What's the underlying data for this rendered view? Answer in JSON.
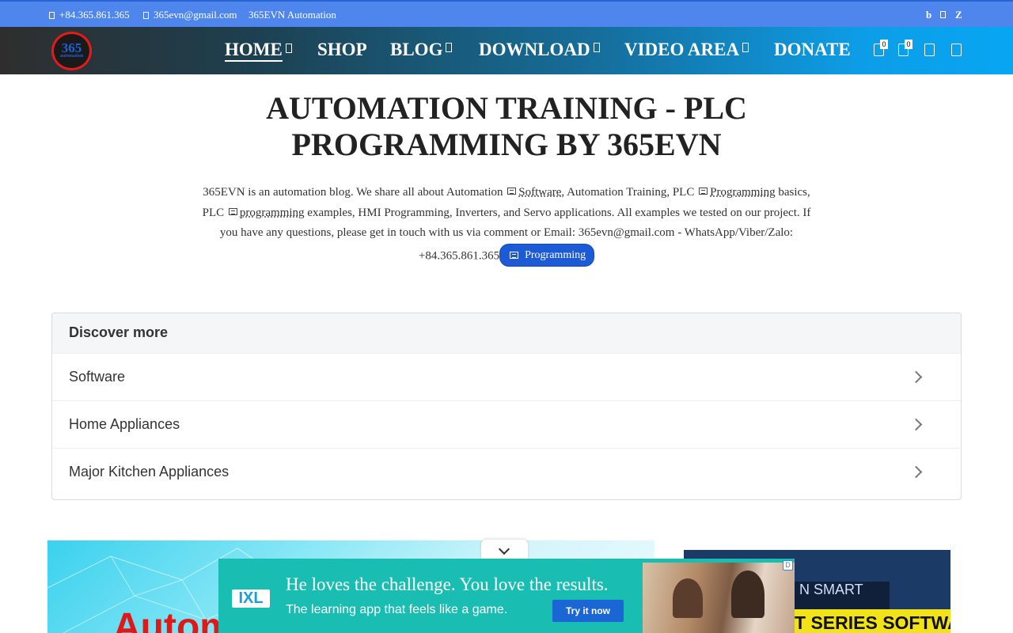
{
  "topbar": {
    "phone": "+84.365.861.365",
    "email": "365evn@gmail.com",
    "brand": "365EVN Automation",
    "social": [
      "b",
      "Z"
    ]
  },
  "nav": {
    "logo_text": "365",
    "logo_sub": "automation",
    "items": [
      {
        "label": "HOME",
        "active": true,
        "dropdown": true
      },
      {
        "label": "SHOP",
        "active": false,
        "dropdown": false
      },
      {
        "label": "BLOG",
        "active": false,
        "dropdown": true
      },
      {
        "label": "DOWNLOAD",
        "active": false,
        "dropdown": true
      },
      {
        "label": "VIDEO AREA",
        "active": false,
        "dropdown": true
      },
      {
        "label": "DONATE",
        "active": false,
        "dropdown": false
      }
    ],
    "wishlist_count": "0",
    "cart_count": "0",
    "icons": [
      "wishlist-icon",
      "cart-icon",
      "account-icon",
      "search-icon"
    ]
  },
  "hero": {
    "title": "AUTOMATION TRAINING - PLC PROGRAMMING BY 365EVN",
    "desc_p1": "365EVN is an automation blog. We share all about Automation",
    "kw1": "Software",
    "desc_p2": ", Automation Training, PLC",
    "kw2": "Programming",
    "desc_p3": " basics, PLC",
    "kw3": "programming",
    "desc_p4": " examples, HMI Programming, Inverters, and Servo applications. All examples we tested on our project. If you have any questions, please get in touch with us via comment or Email: 365evn@gmail.com - WhatsApp/Viber/Zalo: +84.365.861.365",
    "pill": "Programming"
  },
  "discover": {
    "heading": "Discover more",
    "items": [
      "Software",
      "Home Appliances",
      "Major Kitchen Appliances"
    ]
  },
  "lower": {
    "banner_text": "Automa",
    "side_text1": "N SMART",
    "side_text2": "T SERIES SOFTWARE"
  },
  "ad": {
    "logo": "IXL",
    "headline": "He loves the challenge. You love the results.",
    "sub": "The learning app that feels like a game.",
    "cta": "Try it now",
    "info": "D"
  },
  "colors": {
    "topbar": "#4f86ee",
    "pill": "#1d5bd6",
    "ad_bg": "#19bdb2",
    "ad_cta": "#1a66d4"
  }
}
